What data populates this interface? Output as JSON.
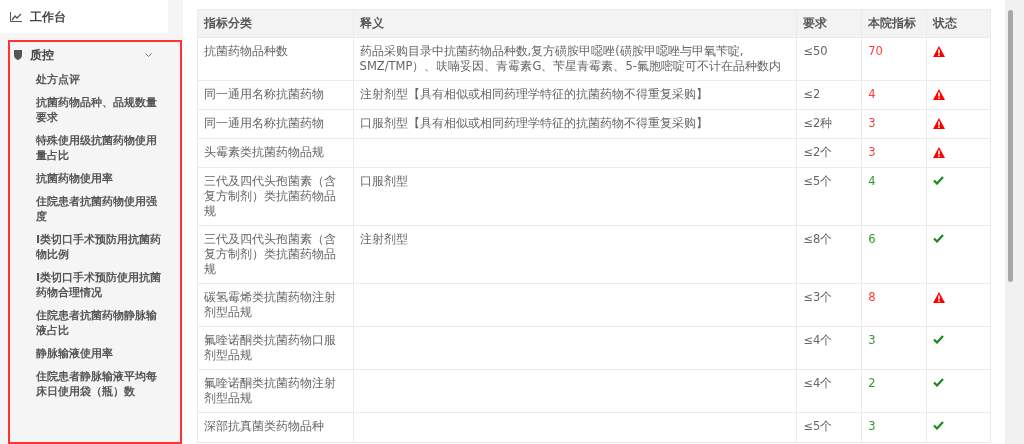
{
  "sidebar": {
    "top_item": {
      "label": "工作台"
    },
    "group": {
      "label": "质控",
      "expanded": true,
      "items": [
        {
          "label": "处方点评"
        },
        {
          "label": "抗菌药物品种、品规数量要求"
        },
        {
          "label": "特殊使用级抗菌药物使用量占比"
        },
        {
          "label": "抗菌药物使用率"
        },
        {
          "label": "住院患者抗菌药物使用强度"
        },
        {
          "label": "I类切口手术预防用抗菌药物比例"
        },
        {
          "label": "I类切口手术预防使用抗菌药物合理情况"
        },
        {
          "label": "住院患者抗菌药物静脉输液占比"
        },
        {
          "label": "静脉输液使用率"
        },
        {
          "label": "住院患者静脉输液平均每床日使用袋（瓶）数"
        }
      ]
    }
  },
  "table": {
    "columns": [
      "指标分类",
      "释义",
      "要求",
      "本院指标",
      "状态"
    ],
    "rows": [
      {
        "category": "抗菌药物品种数",
        "definition": "药品采购目录中抗菌药物品种数,复方磺胺甲噁唑(磺胺甲噁唑与甲氧苄啶, SMZ/TMP）、呋喃妥因、青霉素G、苄星青霉素、5-氟胞嘧啶可不计在品种数内",
        "requirement": "≤50",
        "value": "70",
        "alert": true
      },
      {
        "category": "同一通用名称抗菌药物",
        "definition": "注射剂型【具有相似或相同药理学特征的抗菌药物不得重复采购】",
        "requirement": "≤2",
        "value": "4",
        "alert": true
      },
      {
        "category": "同一通用名称抗菌药物",
        "definition": "口服剂型【具有相似或相同药理学特征的抗菌药物不得重复采购】",
        "requirement": "≤2种",
        "value": "3",
        "alert": true
      },
      {
        "category": "头霉素类抗菌药物品规",
        "definition": "",
        "requirement": "≤2个",
        "value": "3",
        "alert": true
      },
      {
        "category": "三代及四代头孢菌素（含复方制剂）类抗菌药物品规",
        "definition": "口服剂型",
        "requirement": "≤5个",
        "value": "4",
        "alert": false
      },
      {
        "category": "三代及四代头孢菌素（含复方制剂）类抗菌药物品规",
        "definition": "注射剂型",
        "requirement": "≤8个",
        "value": "6",
        "alert": false
      },
      {
        "category": "碳氢霉烯类抗菌药物注射剂型品规",
        "definition": "",
        "requirement": "≤3个",
        "value": "8",
        "alert": true
      },
      {
        "category": "氟喹诺酮类抗菌药物口服剂型品规",
        "definition": "",
        "requirement": "≤4个",
        "value": "3",
        "alert": false
      },
      {
        "category": "氟喹诺酮类抗菌药物注射剂型品规",
        "definition": "",
        "requirement": "≤4个",
        "value": "2",
        "alert": false
      },
      {
        "category": "深部抗真菌类药物品种",
        "definition": "",
        "requirement": "≤5个",
        "value": "3",
        "alert": false
      }
    ]
  }
}
